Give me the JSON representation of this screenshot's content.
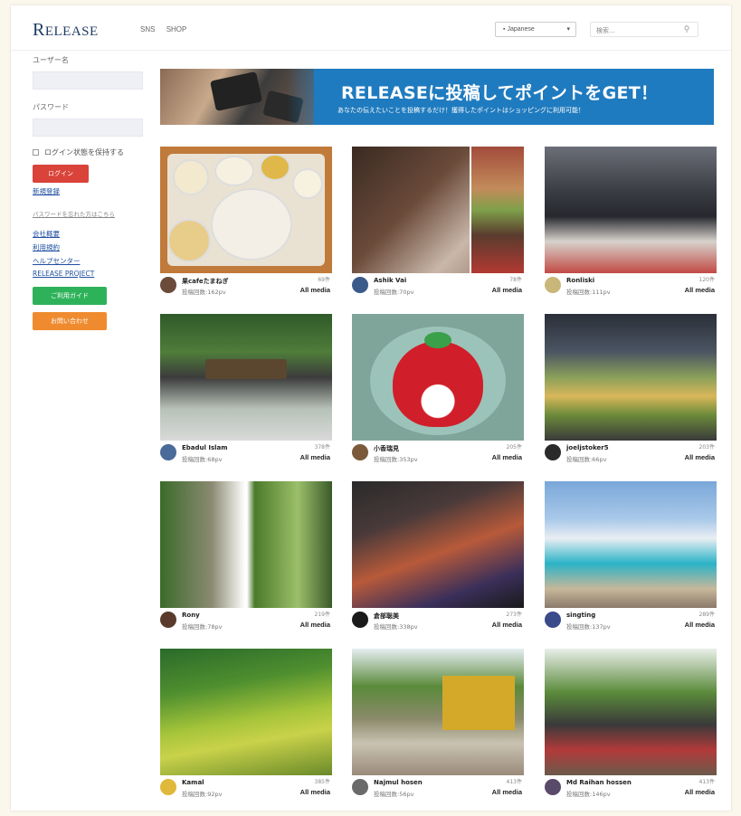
{
  "header": {
    "logo": "RELEASE",
    "logo_first": "R",
    "logo_rest": "ELEASE",
    "nav": [
      "SNS",
      "SHOP"
    ],
    "language": "Japanese",
    "search_placeholder": "検索..."
  },
  "sidebar": {
    "username_label": "ユーザー名",
    "password_label": "パスワード",
    "remember_label": "ログイン状態を保持する",
    "login_button": "ログイン",
    "register_link": "新規登録",
    "forgot_link": "パスワードを忘れた方はこちら",
    "links": [
      "会社概要",
      "利用規約",
      "ヘルプセンター",
      "RELEASE PROJECT"
    ],
    "guide_button": "ご利用ガイド",
    "contact_button": "お問い合わせ"
  },
  "banner": {
    "title": "RELEASEに投稿してポイントをGET！",
    "subtitle": "あなたの伝えたいことを投稿するだけ！獲得したポイントはショッピングに利用可能！"
  },
  "colors": {
    "brand_blue": "#1f7bbf",
    "login_red": "#d9433a",
    "guide_green": "#2db25a",
    "contact_orange": "#ef8b2e"
  },
  "posts": [
    {
      "user": "果cafeたまねぎ",
      "posts": "投稿回数:162pv",
      "count": "69件",
      "media": "All media"
    },
    {
      "user": "Ashik Vai",
      "posts": "投稿回数:70pv",
      "count": "78件",
      "media": "All media"
    },
    {
      "user": "Ronliski",
      "posts": "投稿回数:111pv",
      "count": "120件",
      "media": "All media"
    },
    {
      "user": "Ebadul Islam",
      "posts": "投稿回数:68pv",
      "count": "378件",
      "media": "All media"
    },
    {
      "user": "小香瑞見",
      "posts": "投稿回数:353pv",
      "count": "205件",
      "media": "All media"
    },
    {
      "user": "joeljstoker5",
      "posts": "投稿回数:66pv",
      "count": "203件",
      "media": "All media"
    },
    {
      "user": "Rony",
      "posts": "投稿回数:78pv",
      "count": "219件",
      "media": "All media"
    },
    {
      "user": "倉部聡美",
      "posts": "投稿回数:338pv",
      "count": "273件",
      "media": "All media"
    },
    {
      "user": "singting",
      "posts": "投稿回数:137pv",
      "count": "289件",
      "media": "All media"
    },
    {
      "user": "Kamal",
      "posts": "投稿回数:92pv",
      "count": "385件",
      "media": "All media"
    },
    {
      "user": "Najmul hosen",
      "posts": "投稿回数:56pv",
      "count": "413件",
      "media": "All media"
    },
    {
      "user": "Md Raihan hossen",
      "posts": "投稿回数:146pv",
      "count": "413件",
      "media": "All media"
    }
  ]
}
